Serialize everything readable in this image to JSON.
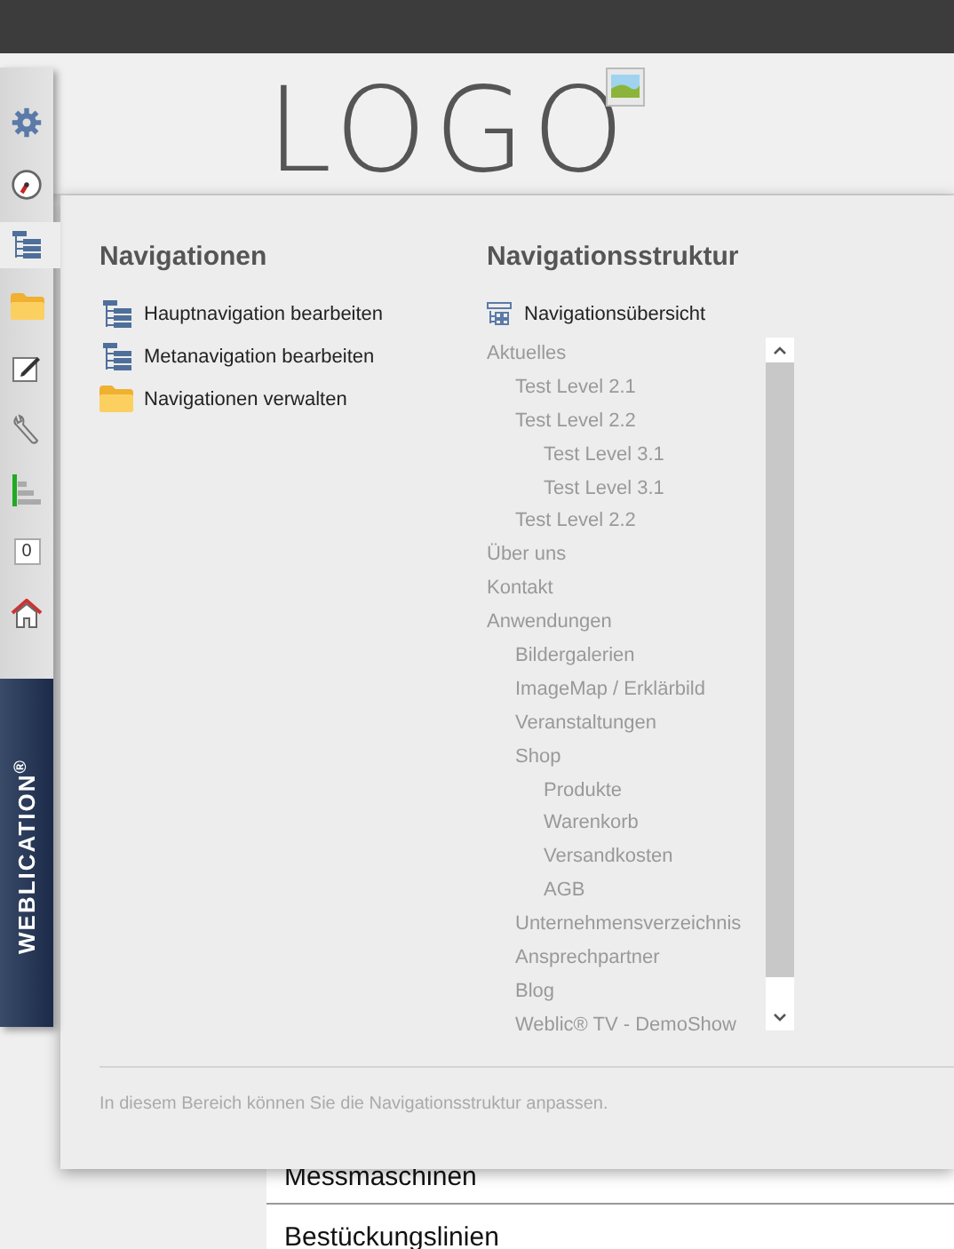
{
  "header": {
    "logo": "LOGO"
  },
  "sidebar": {
    "items": [
      {
        "kind": "gear",
        "selected": false
      },
      {
        "kind": "gauge",
        "selected": false
      },
      {
        "kind": "tree",
        "selected": true
      },
      {
        "kind": "folder",
        "selected": false
      },
      {
        "kind": "edit",
        "selected": false
      },
      {
        "kind": "wrench",
        "selected": false
      },
      {
        "kind": "bars",
        "selected": false
      },
      {
        "kind": "counter",
        "selected": false,
        "text": "0"
      },
      {
        "kind": "home",
        "selected": false
      }
    ],
    "brand": "WEBLICATION$^{®}$"
  },
  "panel": {
    "left": {
      "title": "Navigationen",
      "items": [
        {
          "kind": "tree",
          "label": "Hauptnavigation bearbeiten"
        },
        {
          "kind": "tree",
          "label": "Metanavigation bearbeiten"
        },
        {
          "kind": "folder",
          "label": "Navigationen verwalten"
        }
      ]
    },
    "right": {
      "title": "Navigationsstruktur",
      "overview": "Navigationsübersicht",
      "tree": [
        {
          "label": "Aktuelles",
          "children": [
            {
              "label": "Test Level 2.1"
            },
            {
              "label": "Test Level 2.2",
              "children": [
                {
                  "label": "Test Level 3.1"
                },
                {
                  "label": "Test Level 3.1"
                }
              ]
            },
            {
              "label": "Test Level 2.2"
            }
          ]
        },
        {
          "label": "Über uns"
        },
        {
          "label": "Kontakt"
        },
        {
          "label": "Anwendungen",
          "children": [
            {
              "label": "Bildergalerien"
            },
            {
              "label": "ImageMap / Erklärbild"
            },
            {
              "label": "Veranstaltungen"
            },
            {
              "label": "Shop",
              "children": [
                {
                  "label": "Produkte"
                },
                {
                  "label": "Warenkorb"
                },
                {
                  "label": "Versandkosten"
                },
                {
                  "label": "AGB"
                }
              ]
            },
            {
              "label": "Unternehmensverzeichnis"
            },
            {
              "label": "Ansprechpartner"
            },
            {
              "label": "Blog"
            },
            {
              "label": "Weblic® TV - DemoShow"
            }
          ]
        }
      ]
    },
    "footer": "In diesem Bereich können Sie die Navigationsstruktur anpassen."
  },
  "page_rows": [
    "Messmaschinen",
    "Bestückungslinien"
  ]
}
